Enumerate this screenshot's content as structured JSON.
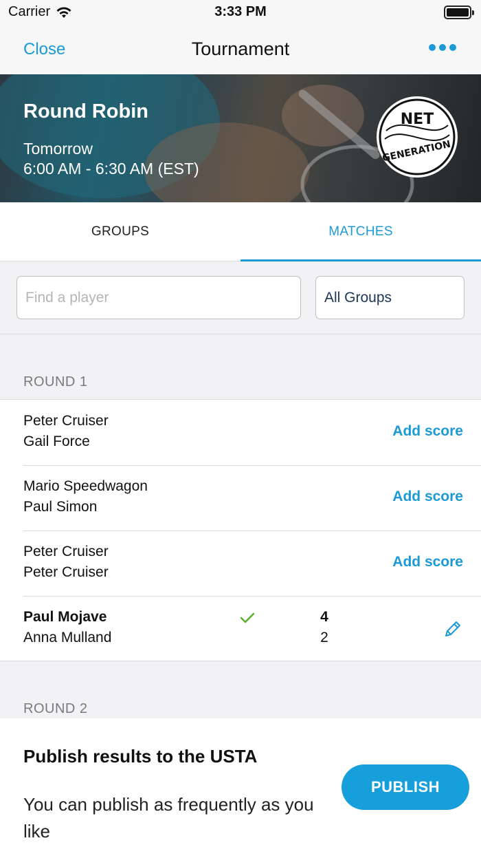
{
  "status_bar": {
    "carrier": "Carrier",
    "time": "3:33 PM"
  },
  "nav": {
    "close_label": "Close",
    "title": "Tournament"
  },
  "hero": {
    "title": "Round Robin",
    "day": "Tomorrow",
    "time_range": "6:00 AM - 6:30 AM (EST)",
    "logo": "NET GENERATION"
  },
  "tabs": [
    {
      "label": "GROUPS",
      "active": false
    },
    {
      "label": "MATCHES",
      "active": true
    }
  ],
  "filters": {
    "search_placeholder": "Find a player",
    "group_select": "All Groups"
  },
  "rounds": [
    {
      "header": "ROUND 1",
      "matches": [
        {
          "player1": "Peter Cruiser",
          "player2": "Gail Force",
          "action": "Add score"
        },
        {
          "player1": "Mario Speedwagon",
          "player2": "Paul Simon",
          "action": "Add score"
        },
        {
          "player1": "Peter Cruiser",
          "player2": "Peter Cruiser",
          "action": "Add score"
        },
        {
          "player1": "Paul Mojave",
          "player2": "Anna Mulland",
          "score1": "4",
          "score2": "2",
          "winner": "player1"
        }
      ]
    },
    {
      "header": "ROUND 2"
    }
  ],
  "publish": {
    "title": "Publish results to the USTA",
    "description": "You can publish as frequently as you like",
    "button_label": "PUBLISH"
  },
  "colors": {
    "accent": "#1b9ad6",
    "check": "#5cb02c",
    "publish_button": "#169fda"
  }
}
